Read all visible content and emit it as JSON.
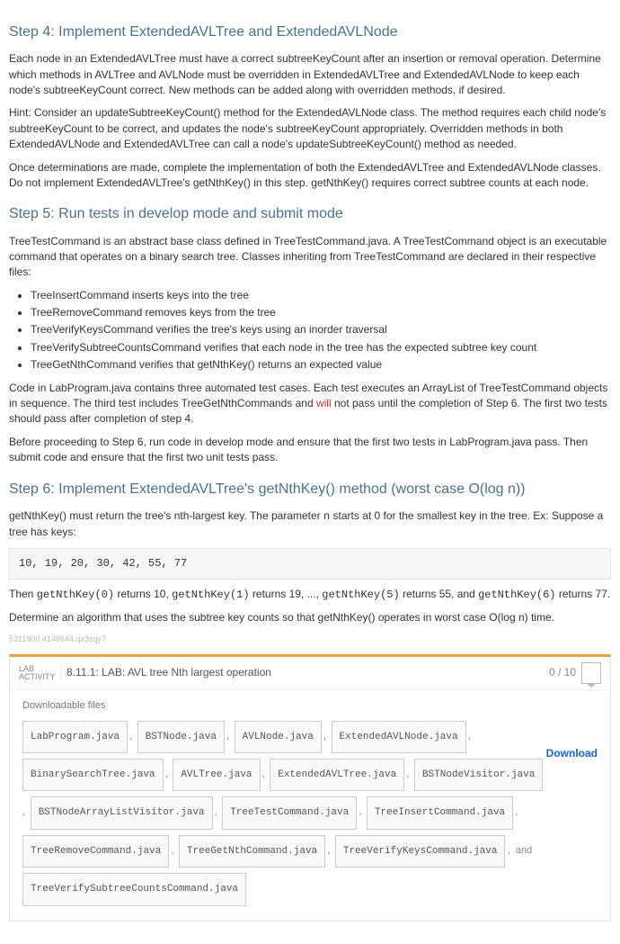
{
  "step4": {
    "heading": "Step 4: Implement ExtendedAVLTree and ExtendedAVLNode",
    "p1": "Each node in an ExtendedAVLTree must have a correct subtreeKeyCount after an insertion or removal operation. Determine which methods in AVLTree and AVLNode must be overridden in ExtendedAVLTree and ExtendedAVLNode to keep each node's subtreeKeyCount correct. New methods can be added along with overridden methods, if desired.",
    "p2": "Hint: Consider an updateSubtreeKeyCount() method for the ExtendedAVLNode class. The method requires each child node's subtreeKeyCount to be correct, and updates the node's subtreeKeyCount appropriately. Overridden methods in both ExtendedAVLNode and ExtendedAVLTree can call a node's updateSubtreeKeyCount() method as needed.",
    "p3": "Once determinations are made, complete the implementation of both the ExtendedAVLTree and ExtendedAVLNode classes. Do not implement ExtendedAVLTree's getNthKey() in this step. getNthKey() requires correct subtree counts at each node."
  },
  "step5": {
    "heading": "Step 5: Run tests in develop mode and submit mode",
    "p1": "TreeTestCommand is an abstract base class defined in TreeTestCommand.java. A TreeTestCommand object is an executable command that operates on a binary search tree. Classes inheriting from TreeTestCommand are declared in their respective files:",
    "items": [
      "TreeInsertCommand inserts keys into the tree",
      "TreeRemoveCommand removes keys from the tree",
      "TreeVerifyKeysCommand verifies the tree's keys using an inorder traversal",
      "TreeVerifySubtreeCountsCommand verifies that each node in the tree has the expected subtree key count",
      "TreeGetNthCommand verifies that getNthKey() returns an expected value"
    ],
    "p2a": "Code in LabProgram.java contains three automated test cases. Each test executes an ArrayList of TreeTestCommand objects in sequence. The third test includes TreeGetNthCommands and ",
    "p2will": "will",
    "p2b": " not pass until the completion of Step 6. The first two tests should pass after completion of step 4.",
    "p3": "Before proceeding to Step 6, run code in develop mode and ensure that the first two tests in LabProgram.java pass. Then submit code and ensure that the first two unit tests pass."
  },
  "step6": {
    "heading": "Step 6: Implement ExtendedAVLTree's getNthKey() method (worst case O(log n))",
    "p1a": "getNthKey() must return the tree's nth-largest key. The parameter ",
    "p1code": "n",
    "p1b": " starts at 0 for the smallest key in the tree. Ex: Suppose a tree has keys:",
    "codeblock": "10, 19, 20, 30, 42, 55, 77",
    "p2_parts": {
      "a": "Then ",
      "c1": "getNthKey(0)",
      "b": " returns 10, ",
      "c2": "getNthKey(1)",
      "c": " returns 19, ..., ",
      "c3": "getNthKey(5)",
      "d": " returns 55, and ",
      "c4": "getNthKey(6)",
      "e": " returns 77."
    },
    "p3": "Determine an algorithm that uses the subtree key counts so that getNthKey() operates in worst case O(log n) time."
  },
  "footer_id": "5311800.4148644.qx3zqy7",
  "lab": {
    "label_line1": "LAB",
    "label_line2": "ACTIVITY",
    "title": "8.11.1: LAB: AVL tree Nth largest operation",
    "score": "0 / 10",
    "downloadable_label": "Downloadable files",
    "files": [
      "LabProgram.java",
      "BSTNode.java",
      "AVLNode.java",
      "ExtendedAVLNode.java",
      "BinarySearchTree.java",
      "AVLTree.java",
      "ExtendedAVLTree.java",
      "BSTNodeVisitor.java",
      "BSTNodeArrayListVisitor.java",
      "TreeTestCommand.java",
      "TreeInsertCommand.java",
      "TreeRemoveCommand.java",
      "TreeGetNthCommand.java",
      "TreeVerifyKeysCommand.java",
      "TreeVerifySubtreeCountsCommand.java"
    ],
    "and_word": "and",
    "download_label": "Download"
  }
}
